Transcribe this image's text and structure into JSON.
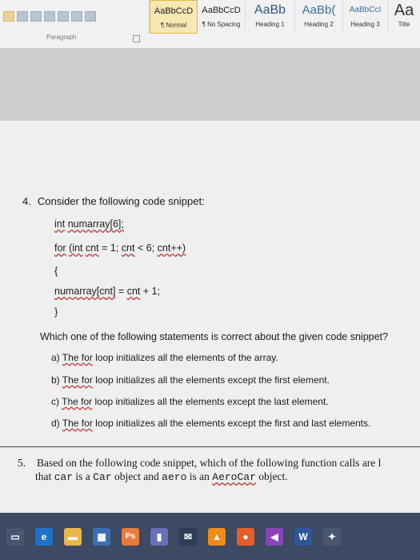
{
  "ribbon": {
    "styles": [
      {
        "preview": "AaBbCcD",
        "name": "¶ Normal",
        "active": true
      },
      {
        "preview": "AaBbCcD",
        "name": "¶ No Spacing",
        "active": false
      },
      {
        "preview": "AaBb",
        "name": "Heading 1",
        "active": false
      },
      {
        "preview": "AaBb(",
        "name": "Heading 2",
        "active": false
      },
      {
        "preview": "AaBbCcI",
        "name": "Heading 3",
        "active": false
      },
      {
        "preview": "Aa",
        "name": "Title",
        "active": false
      }
    ],
    "paragraph_label": "Paragraph"
  },
  "question4": {
    "number": "4.",
    "prompt": "Consider the following code snippet:",
    "code": {
      "decl_type": "int",
      "decl_name": "numarray[6];",
      "for_kw": "for",
      "for_open": "(int",
      "for_var": "cnt",
      "for_rest1": "= 1;",
      "for_var2": "cnt",
      "for_rest2": "< 6;",
      "for_inc": "cnt++)",
      "brace_open": "{",
      "body_arr": "numarray[cnt]",
      "body_eq": "=",
      "body_var": "cnt",
      "body_rest": "+ 1;",
      "brace_close": "}"
    },
    "question": "Which one of the following statements is correct about the given code snippet?",
    "options": [
      {
        "letter": "a)",
        "for": "The for",
        "rest": "loop initializes all the elements of the array."
      },
      {
        "letter": "b)",
        "for": "The for",
        "rest": "loop initializes all the elements except the first element."
      },
      {
        "letter": "c)",
        "for": "The for",
        "rest": "loop initializes all the elements except the last element."
      },
      {
        "letter": "d)",
        "for": "The for",
        "rest": "loop initializes all the elements except the first and last elements."
      }
    ]
  },
  "question5": {
    "number": "5.",
    "line1": "Based on the following code snippet, which of the following function calls are l",
    "line2_a": "that",
    "line2_car": "car",
    "line2_b": "is a",
    "line2_Car": "Car",
    "line2_c": "object and",
    "line2_aero": "aero",
    "line2_d": "is an",
    "line2_AeroCar": "AeroCar",
    "line2_e": "object."
  },
  "taskbar": {
    "items": [
      {
        "icon": "task-view-icon",
        "color": "#4a5670",
        "glyph": "▭"
      },
      {
        "icon": "edge-icon",
        "color": "#1e73c9",
        "glyph": "e"
      },
      {
        "icon": "file-explorer-icon",
        "color": "#e6b84a",
        "glyph": "▬"
      },
      {
        "icon": "store-icon",
        "color": "#3b6fb0",
        "glyph": "▦"
      },
      {
        "icon": "photoshop-icon",
        "color": "#e87a3c",
        "glyph": "Ps"
      },
      {
        "icon": "onenote-icon",
        "color": "#6a6fb7",
        "glyph": "▮"
      },
      {
        "icon": "mail-icon",
        "color": "#2f3d55",
        "glyph": "✉"
      },
      {
        "icon": "vlc-icon",
        "color": "#f08a1c",
        "glyph": "▲"
      },
      {
        "icon": "firefox-icon",
        "color": "#e65d2a",
        "glyph": "●"
      },
      {
        "icon": "media-icon",
        "color": "#8844bb",
        "glyph": "◀"
      },
      {
        "icon": "word-icon",
        "color": "#2b579a",
        "glyph": "W"
      },
      {
        "icon": "tool-icon",
        "color": "#4a5670",
        "glyph": "✦"
      }
    ]
  }
}
